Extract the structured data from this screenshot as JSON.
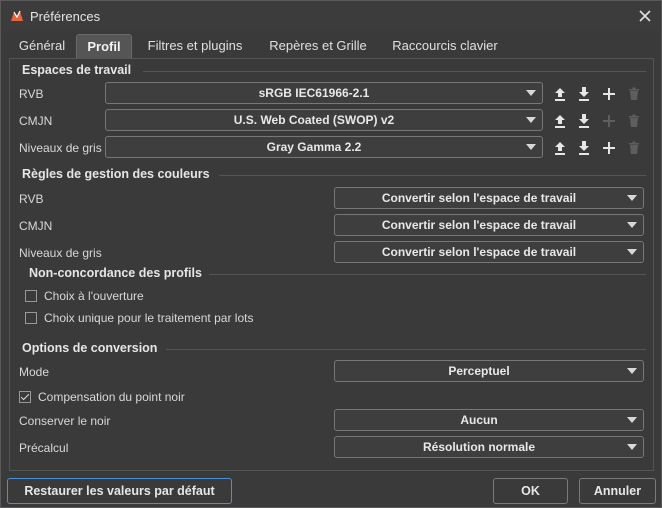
{
  "window": {
    "title": "Préférences"
  },
  "tabs": [
    {
      "label": "Général"
    },
    {
      "label": "Profil"
    },
    {
      "label": "Filtres et plugins"
    },
    {
      "label": "Repères et Grille"
    },
    {
      "label": "Raccourcis clavier"
    }
  ],
  "workspaces": {
    "title": "Espaces de travail",
    "rows": [
      {
        "label": "RVB",
        "value": "sRGB IEC61966-2.1"
      },
      {
        "label": "CMJN",
        "value": "U.S. Web Coated (SWOP) v2"
      },
      {
        "label": "Niveaux de gris",
        "value": "Gray Gamma 2.2"
      }
    ]
  },
  "rules": {
    "title": "Règles de gestion des couleurs",
    "rows": [
      {
        "label": "RVB",
        "value": "Convertir selon l'espace de travail"
      },
      {
        "label": "CMJN",
        "value": "Convertir selon l'espace de travail"
      },
      {
        "label": "Niveaux de gris",
        "value": "Convertir selon l'espace de travail"
      }
    ]
  },
  "mismatch": {
    "title": "Non-concordance des profils",
    "open_label": "Choix à l'ouverture",
    "open_checked": false,
    "batch_label": "Choix unique pour le traitement par lots",
    "batch_checked": false
  },
  "conversion": {
    "title": "Options de conversion",
    "mode_label": "Mode",
    "mode_value": "Perceptuel",
    "black_point_label": "Compensation du point noir",
    "black_point_checked": true,
    "keep_black_label": "Conserver le noir",
    "keep_black_value": "Aucun",
    "precalc_label": "Précalcul",
    "precalc_value": "Résolution normale"
  },
  "footer": {
    "restore_label": "Restaurer les valeurs par défaut",
    "ok_label": "OK",
    "cancel_label": "Annuler"
  },
  "colors": {
    "accent": "#4a90d9",
    "background": "#3a3a3a",
    "text": "#dcdcdc"
  },
  "icons": [
    "app-icon",
    "close-icon",
    "upload-icon",
    "download-icon",
    "plus-icon",
    "trash-icon",
    "chevron-down-icon"
  ]
}
